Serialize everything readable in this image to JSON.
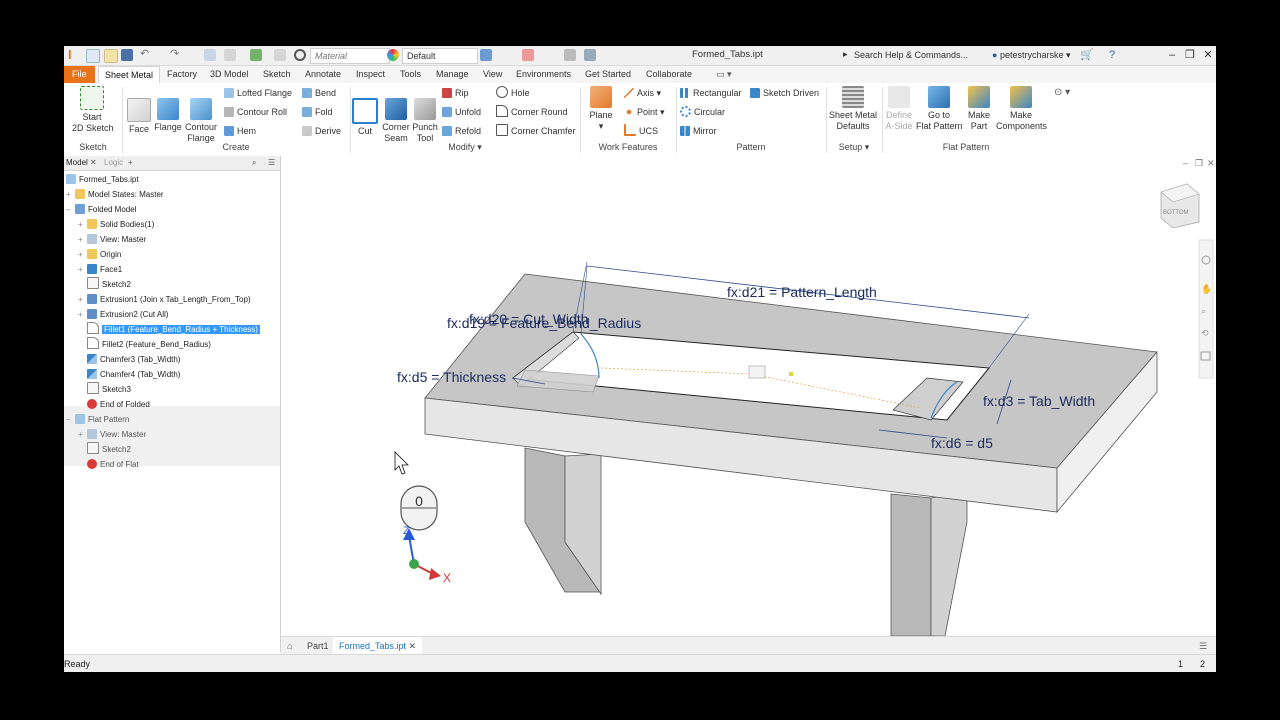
{
  "titlebar": {
    "material": "Material",
    "appearance": "Default",
    "document_title": "Formed_Tabs.ipt",
    "search_placeholder": "Search Help & Commands...",
    "user": "petestrycharske"
  },
  "ribbon_tabs": [
    "File",
    "Sheet Metal",
    "Factory",
    "3D Model",
    "Sketch",
    "Annotate",
    "Inspect",
    "Tools",
    "Manage",
    "View",
    "Environments",
    "Get Started",
    "Collaborate"
  ],
  "ribbon": {
    "start_sketch": "Start\n2D Sketch",
    "face": "Face",
    "flange": "Flange",
    "contour_flange": "Contour\nFlange",
    "lofted_flange": "Lofted Flange",
    "contour_roll": "Contour Roll",
    "hem": "Hem",
    "bend": "Bend",
    "fold": "Fold",
    "derive": "Derive",
    "cut": "Cut",
    "corner_seam": "Corner\nSeam",
    "punch_tool": "Punch\nTool",
    "rip": "Rip",
    "unfold": "Unfold",
    "refold": "Refold",
    "hole": "Hole",
    "corner_round": "Corner Round",
    "corner_chamfer": "Corner Chamfer",
    "plane": "Plane",
    "axis": "Axis",
    "point": "Point",
    "ucs": "UCS",
    "rectangular": "Rectangular",
    "circular": "Circular",
    "mirror": "Mirror",
    "sketch_driven": "Sketch Driven",
    "sheet_metal_defaults": "Sheet Metal\nDefaults",
    "define_a_side": "Define\nA-Side",
    "go_to_flat_pattern": "Go to\nFlat Pattern",
    "make_part": "Make\nPart",
    "make_components": "Make\nComponents",
    "groups": {
      "sketch": "Sketch",
      "create": "Create",
      "modify": "Modify",
      "work_features": "Work Features",
      "pattern": "Pattern",
      "setup": "Setup",
      "flat_pattern": "Flat Pattern"
    }
  },
  "browser": {
    "tab_model": "Model",
    "tab_logic": "Logic",
    "items": [
      {
        "label": "Formed_Tabs.ipt"
      },
      {
        "label": "Model States: Master"
      },
      {
        "label": "Folded Model"
      },
      {
        "label": "Solid Bodies(1)"
      },
      {
        "label": "View: Master"
      },
      {
        "label": "Origin"
      },
      {
        "label": "Face1"
      },
      {
        "label": "Sketch2"
      },
      {
        "label": "Extrusion1 (Join x Tab_Length_From_Top)"
      },
      {
        "label": "Extrusion2 (Cut All)"
      },
      {
        "label": "Fillet1 (Feature_Bend_Radius + Thickness)"
      },
      {
        "label": "Fillet2 (Feature_Bend_Radius)"
      },
      {
        "label": "Chamfer3 (Tab_Width)"
      },
      {
        "label": "Chamfer4 (Tab_Width)"
      },
      {
        "label": "Sketch3"
      },
      {
        "label": "End of Folded"
      },
      {
        "label": "Flat Pattern"
      },
      {
        "label": "View: Master"
      },
      {
        "label": "Sketch2"
      },
      {
        "label": "End of Flat"
      }
    ]
  },
  "viewport": {
    "dims": {
      "d21": "fx:d21 = Pattern_Length",
      "d20": "fx:d20 = Cut_Width",
      "d19": "fx:d19 = Feature_Bend_Radius",
      "d5": "fx:d5 = Thickness",
      "d3": "fx:d3 = Tab_Width",
      "d6": "fx:d6 = d5"
    },
    "viewcube_label": "BOTTOM",
    "axis_z": "Z",
    "axis_x": "X"
  },
  "doc_tabs": {
    "part1": "Part1",
    "active": "Formed_Tabs.ipt"
  },
  "status": {
    "text": "Ready",
    "n1": "1",
    "n2": "2"
  }
}
